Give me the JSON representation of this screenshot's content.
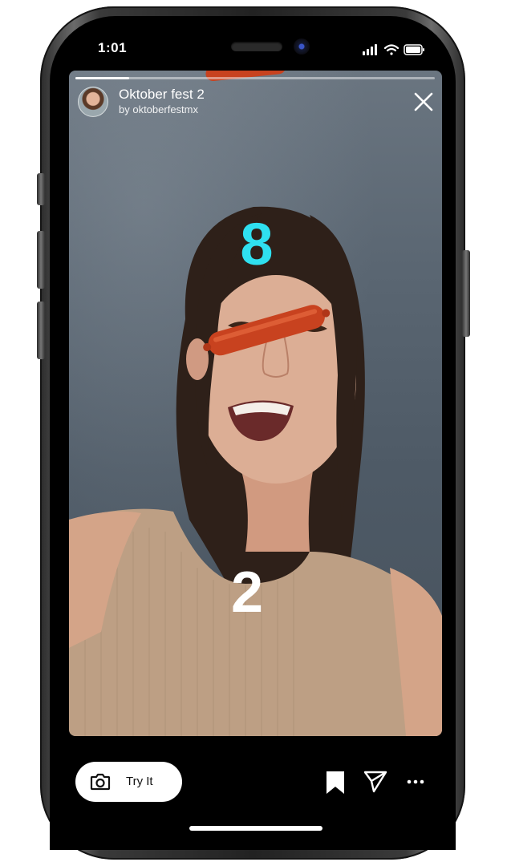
{
  "status_bar": {
    "time": "1:01"
  },
  "story": {
    "progress": 0.15,
    "effect_title": "Oktober fest 2",
    "effect_author": "by oktoberfestmx",
    "score_top": "8",
    "score_bottom": "2"
  },
  "actions": {
    "try_it_label": "Try It",
    "icons": [
      "camera-icon",
      "bookmark-icon",
      "send-icon",
      "more-icon",
      "close-icon"
    ]
  },
  "colors": {
    "score_top": "#2fe0f0",
    "score_bottom": "#ffffff",
    "sausage": "#c8421f",
    "try_it_bg": "#ffffff"
  }
}
